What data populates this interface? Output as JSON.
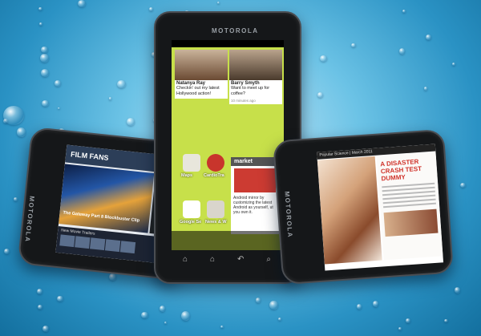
{
  "scene": {
    "description_colors": {
      "background": "#2a92c4",
      "device_body": "#151719"
    }
  },
  "left_phone": {
    "brand": "MOTOROLA",
    "app_title": "FILM FANS",
    "feature_caption": "The Gateway Part 8 Blockbuster Clip",
    "section_label": "New Movie Trailers"
  },
  "center_phone": {
    "brand": "MOTOROLA",
    "contacts": [
      {
        "name": "Natanya Ray",
        "message": "Checkin' out my latest Hollywood action!",
        "time": ""
      },
      {
        "name": "Barry Smyth",
        "message": "Want to meet up for coffee?",
        "time": "10 minutes ago"
      }
    ],
    "apps": [
      {
        "label": "Maps",
        "icon": "maps-icon"
      },
      {
        "label": "CardioTra",
        "icon": "cardio-icon"
      },
      {
        "label": "Google Se",
        "icon": "google-search-icon"
      },
      {
        "label": "News & W",
        "icon": "news-icon"
      }
    ],
    "market": {
      "title": "market",
      "blurb": "Android mirror by customizing the latest Android as yourself, ut you own it."
    },
    "nav_keys": [
      "⌂",
      "⌂",
      "↶",
      "⌕"
    ]
  },
  "right_phone": {
    "brand": "MOTOROLA",
    "magazine_strip": "Popular Science | March 2011",
    "headline": "A DISASTER CRASH TEST DUMMY"
  }
}
